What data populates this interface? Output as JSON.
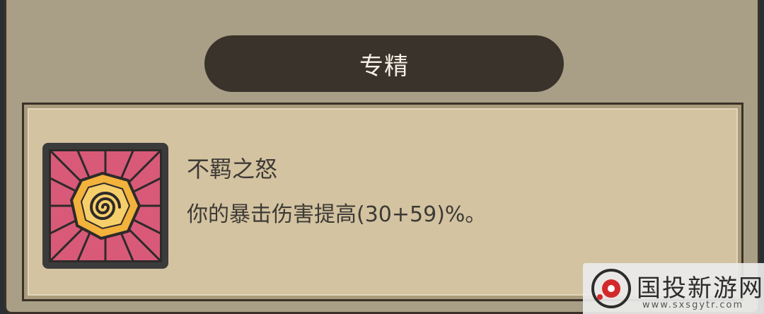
{
  "panel": {
    "title": "专精"
  },
  "skill": {
    "icon": "spiral-burst-icon",
    "name": "不羁之怒",
    "description": "你的暴击伤害提高(30+59)%。"
  },
  "watermark": {
    "title": "国投新游网",
    "url": "www.sxsgytr.com"
  },
  "colors": {
    "panel_bg": "#a89f86",
    "card_bg": "#d3c3a0",
    "title_bar": "#3a332b",
    "icon_pink": "#d85a78",
    "icon_gold": "#f2b23b"
  }
}
